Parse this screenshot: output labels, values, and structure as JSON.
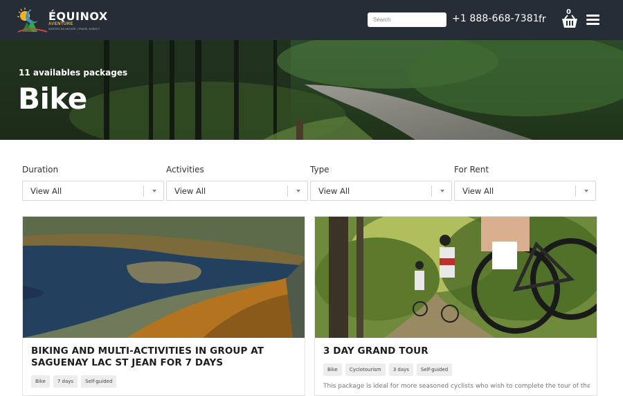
{
  "header": {
    "brand": "ÉQUINOX",
    "brand_sub": "AVENTURE",
    "brand_tagline": "SORTIES EN NATURE | TRAVEL AGENCY",
    "search_placeholder": "Search",
    "phone": "+1 888-668-7381",
    "language": "fr",
    "cart_count": "0"
  },
  "hero": {
    "subtitle": "11 availables packages",
    "title": "Bike"
  },
  "filters": [
    {
      "label": "Duration",
      "value": "View All"
    },
    {
      "label": "Activities",
      "value": "View All"
    },
    {
      "label": "Type",
      "value": "View All"
    },
    {
      "label": "For Rent",
      "value": "View All"
    }
  ],
  "cards": [
    {
      "title": "BIKING AND MULTI-ACTIVITIES IN GROUP AT SAGUENAY LAC ST JEAN FOR 7 DAYS",
      "tags": [
        "Bike",
        "7 days",
        "Self-guided"
      ],
      "description": ""
    },
    {
      "title": "3 DAY GRAND TOUR",
      "tags": [
        "Bike",
        "Cyclotourism",
        "3 days",
        "Self-guided"
      ],
      "description": "This package is ideal for more seasoned cyclists who wish to complete the tour of the Lac"
    }
  ],
  "colors": {
    "header_bg": "#262d36",
    "accent": "#f0b323"
  }
}
